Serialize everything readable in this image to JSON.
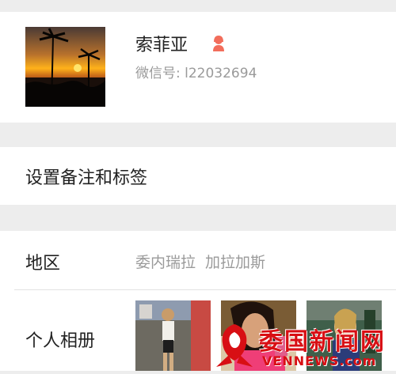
{
  "profile": {
    "name": "索菲亚",
    "gender_icon": "female-user-icon",
    "wechat_id": "微信号: l22032694"
  },
  "remark": {
    "label": "设置备注和标签"
  },
  "region": {
    "label": "地区",
    "value": "委内瑞拉  加拉加斯"
  },
  "album": {
    "label": "个人相册"
  },
  "watermark": {
    "title": "委国新闻网",
    "subtitle": "VENNEWS.com"
  },
  "colors": {
    "background": "#ededed",
    "card": "#ffffff",
    "primary_text": "#222222",
    "secondary_text": "#9a9a9a",
    "gender_icon": "#f26d5b",
    "watermark": "#d80f14"
  }
}
